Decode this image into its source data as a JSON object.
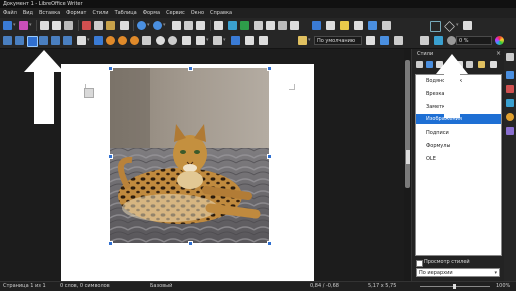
{
  "window": {
    "title": "Документ 1 - LibreOffice Writer"
  },
  "menu": [
    "Файл",
    "Вид",
    "Вставка",
    "Формат",
    "Стили",
    "Таблица",
    "Форма",
    "Сервис",
    "Окно",
    "Справка"
  ],
  "toolbar": {
    "paragraph_style": "По умолчанию",
    "zoom_value": "0 %"
  },
  "sidebar": {
    "title": "Стили",
    "styles": [
      "Водяной знак",
      "Врезка",
      "Заметки",
      "Изображения",
      "Подписи",
      "Формулы",
      "OLE"
    ],
    "selected_style": "Изображения",
    "preview_label": "Просмотр стилей",
    "filter_value": "По иерархии"
  },
  "status": {
    "page": "Страница 1 из 1",
    "words": "0 слов, 0 символов",
    "style": "Базовый",
    "position": "0,84 / -0,68",
    "size": "5,17 x 5,75",
    "zoom": "100%"
  },
  "colors": {
    "selection": "#1e6fd4",
    "annotation_arrow": "#ffffff"
  }
}
